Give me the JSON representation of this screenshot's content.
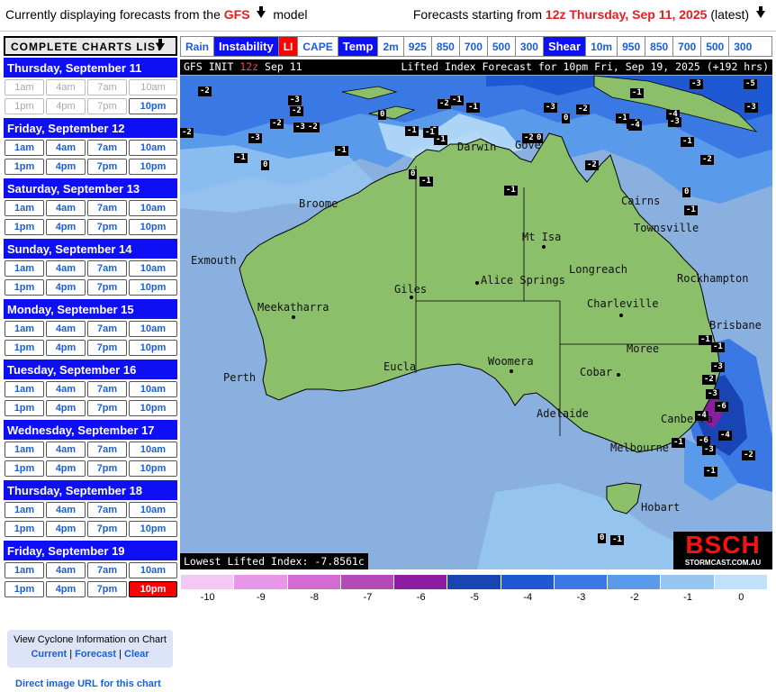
{
  "header": {
    "left_prefix": "Currently displaying forecasts from the",
    "model": "GFS",
    "left_suffix": "model",
    "right_prefix": "Forecasts starting from",
    "run": "12z Thursday, Sep 11, 2025",
    "right_suffix": "(latest)"
  },
  "sidebar": {
    "title": "COMPLETE CHARTS LIST",
    "days": [
      {
        "label": "Thursday, September 11",
        "slots": [
          "1am",
          "4am",
          "7am",
          "10am",
          "1pm",
          "4pm",
          "7pm",
          "10pm"
        ],
        "disabled": [
          0,
          1,
          2,
          3,
          4,
          5,
          6
        ]
      },
      {
        "label": "Friday, September 12",
        "slots": [
          "1am",
          "4am",
          "7am",
          "10am",
          "1pm",
          "4pm",
          "7pm",
          "10pm"
        ],
        "disabled": []
      },
      {
        "label": "Saturday, September 13",
        "slots": [
          "1am",
          "4am",
          "7am",
          "10am",
          "1pm",
          "4pm",
          "7pm",
          "10pm"
        ],
        "disabled": []
      },
      {
        "label": "Sunday, September 14",
        "slots": [
          "1am",
          "4am",
          "7am",
          "10am",
          "1pm",
          "4pm",
          "7pm",
          "10pm"
        ],
        "disabled": []
      },
      {
        "label": "Monday, September 15",
        "slots": [
          "1am",
          "4am",
          "7am",
          "10am",
          "1pm",
          "4pm",
          "7pm",
          "10pm"
        ],
        "disabled": []
      },
      {
        "label": "Tuesday, September 16",
        "slots": [
          "1am",
          "4am",
          "7am",
          "10am",
          "1pm",
          "4pm",
          "7pm",
          "10pm"
        ],
        "disabled": []
      },
      {
        "label": "Wednesday, September 17",
        "slots": [
          "1am",
          "4am",
          "7am",
          "10am",
          "1pm",
          "4pm",
          "7pm",
          "10pm"
        ],
        "disabled": []
      },
      {
        "label": "Thursday, September 18",
        "slots": [
          "1am",
          "4am",
          "7am",
          "10am",
          "1pm",
          "4pm",
          "7pm",
          "10pm"
        ],
        "disabled": []
      },
      {
        "label": "Friday, September 19",
        "slots": [
          "1am",
          "4am",
          "7am",
          "10am",
          "1pm",
          "4pm",
          "7pm",
          "10pm"
        ],
        "disabled": [],
        "selected": 7
      }
    ],
    "cyclone": {
      "line1": "View Cyclone Information on Chart",
      "current": "Current",
      "forecast": "Forecast",
      "clear": "Clear"
    },
    "direct_link": "Direct image URL for this chart"
  },
  "tabs": [
    {
      "label": "Rain",
      "kind": "link"
    },
    {
      "label": "Instability",
      "kind": "section"
    },
    {
      "label": "LI",
      "kind": "active"
    },
    {
      "label": "CAPE",
      "kind": "link"
    },
    {
      "label": "Temp",
      "kind": "section"
    },
    {
      "label": "2m",
      "kind": "link"
    },
    {
      "label": "925",
      "kind": "link"
    },
    {
      "label": "850",
      "kind": "link"
    },
    {
      "label": "700",
      "kind": "link"
    },
    {
      "label": "500",
      "kind": "link"
    },
    {
      "label": "300",
      "kind": "link"
    },
    {
      "label": "Shear",
      "kind": "section"
    },
    {
      "label": "10m",
      "kind": "link"
    },
    {
      "label": "950",
      "kind": "link"
    },
    {
      "label": "850",
      "kind": "link"
    },
    {
      "label": "700",
      "kind": "link"
    },
    {
      "label": "500",
      "kind": "link"
    },
    {
      "label": "300",
      "kind": "link"
    }
  ],
  "map": {
    "init_prefix": "GFS INIT",
    "init_run": "12z",
    "init_date": "Sep 11",
    "title": "Lifted Index Forecast for 10pm Fri, Sep 19, 2025 (+192 hrs)",
    "lowest": "Lowest Lifted Index: -7.8561c",
    "logo_big": "BSCH",
    "logo_small": "STORMCAST.COM.AU",
    "cities": [
      "Darwin",
      "Gove",
      "Broome",
      "Cairns",
      "Townsville",
      "Mt Isa",
      "Exmouth",
      "Longreach",
      "Rockhampton",
      "Giles",
      "Alice Springs",
      "Meekatharra",
      "Charleville",
      "Brisbane",
      "Moree",
      "Eucla",
      "Woomera",
      "Perth",
      "Cobar",
      "Adelaide",
      "Canberra",
      "Melbourne",
      "Hobart"
    ],
    "values": [
      "-2",
      "-3",
      "-2",
      "-3",
      "-3",
      "-1",
      "-1",
      "-2",
      "0",
      "-1",
      "-1",
      "0",
      "-2",
      "-1",
      "0",
      "-2",
      "-3",
      "-2",
      "-1",
      "-1",
      "-2",
      "0",
      "-1",
      "-1",
      "0",
      "-2",
      "-3",
      "-4",
      "-4",
      "-5",
      "-3",
      "-3",
      "-4",
      "-2",
      "-1",
      "-2",
      "-1",
      "-1",
      "0",
      "0",
      "-1",
      "-1",
      "-1",
      "-3",
      "-2",
      "-3",
      "-6",
      "-4",
      "-6",
      "-3",
      "-1",
      "-2",
      "-4",
      "-1",
      "0",
      "-1"
    ]
  },
  "legend": {
    "labels": [
      "-10",
      "-9",
      "-8",
      "-7",
      "-6",
      "-5",
      "-4",
      "-3",
      "-2",
      "-1",
      "0"
    ],
    "colors": [
      "#f4c8f4",
      "#e896e8",
      "#d46ad4",
      "#b44ab8",
      "#8c1ca0",
      "#1844b4",
      "#1e58d2",
      "#3a78e4",
      "#5a9aea",
      "#96c6f0",
      "#bfe2fa"
    ]
  }
}
